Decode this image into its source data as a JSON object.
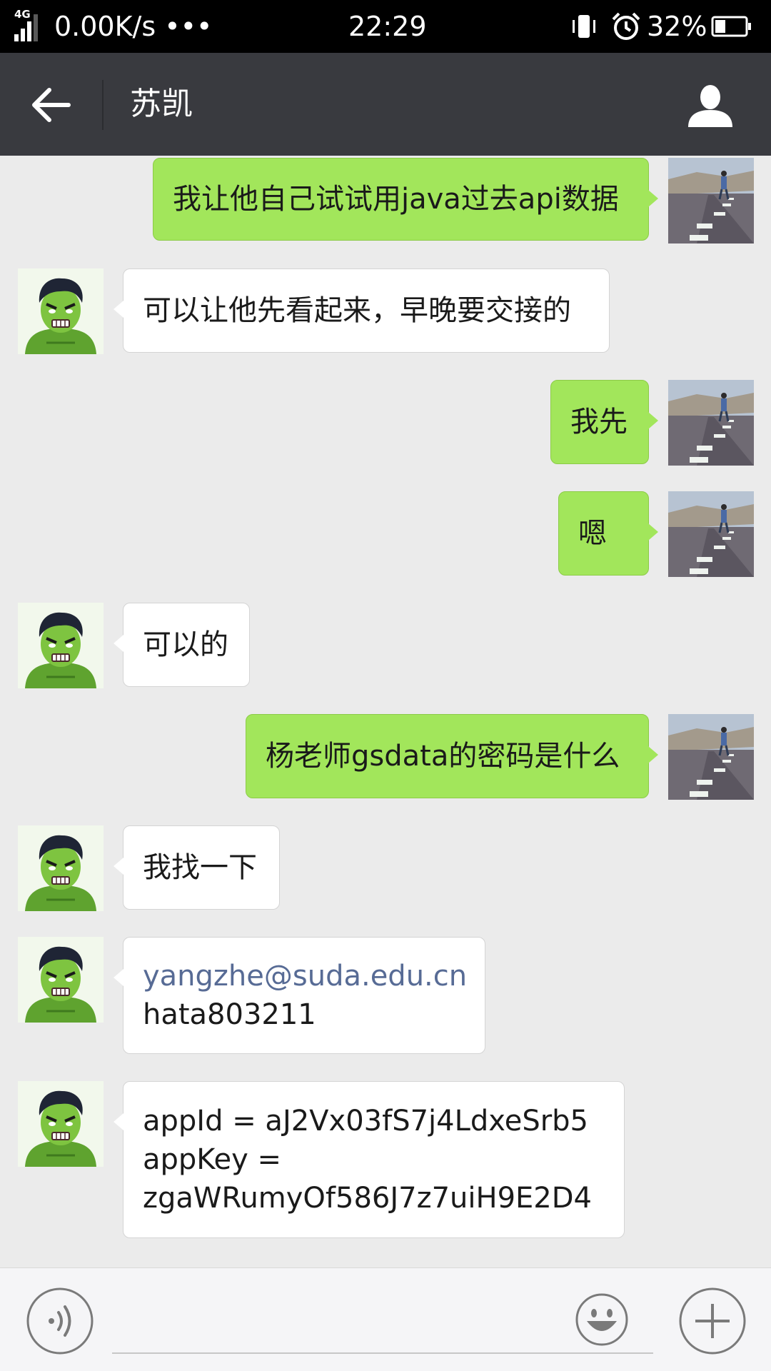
{
  "status_bar": {
    "network": "4G",
    "speed": "0.00K/s •••",
    "time": "22:29",
    "battery": "32%",
    "icons": [
      "signal-icon",
      "vibrate-icon",
      "alarm-icon",
      "battery-icon"
    ]
  },
  "nav": {
    "title": "苏凯",
    "back_icon": "back-arrow-icon",
    "profile_icon": "person-icon"
  },
  "messages": [
    {
      "side": "out",
      "text": "我让他自己试试用java过去api数据"
    },
    {
      "side": "in",
      "text": "可以让他先看起来，早晚要交接的"
    },
    {
      "side": "out",
      "text": "我先"
    },
    {
      "side": "out",
      "text": "嗯"
    },
    {
      "side": "in",
      "text": "可以的"
    },
    {
      "side": "out",
      "text": "杨老师gsdata的密码是什么"
    },
    {
      "side": "in",
      "text": "我找一下"
    },
    {
      "side": "in",
      "link": "yangzhe@suda.edu.cn",
      "text": "hata803211"
    },
    {
      "side": "in",
      "lines": [
        "appId = aJ2Vx03fS7j4LdxeSrb5",
        "appKey =",
        "zgaWRumyOf586J7z7uiH9E2D4"
      ]
    }
  ],
  "input_bar": {
    "placeholder": "",
    "voice_icon": "voice-icon",
    "emoji_icon": "emoji-icon",
    "plus_icon": "plus-icon"
  },
  "colors": {
    "status_bar_bg": "#000000",
    "nav_bg": "#393a3f",
    "chat_bg": "#ebebeb",
    "outgoing_bubble": "#a2e65b",
    "incoming_bubble": "#ffffff",
    "link": "#576b95"
  }
}
